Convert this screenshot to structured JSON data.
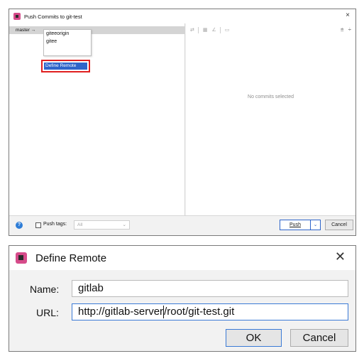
{
  "push_window": {
    "title": "Push Commits to git-test",
    "close_glyph": "×",
    "branch_prefix": "master →",
    "remote_options": [
      "giteeorigin",
      "gitee"
    ],
    "define_remote_label": "Define Remote",
    "empty_state": "No commits selected",
    "toolbar_icons": [
      "move-icon",
      "group-icon",
      "edit-icon",
      "commit-icon"
    ],
    "right_icons": [
      "expand-all-icon",
      "collapse-all-icon"
    ],
    "push_tags_label": "Push tags:",
    "push_tags_value": "All",
    "push_label": "Push",
    "cancel_label": "Cancel",
    "colors": {
      "highlight_border": "#e02020",
      "selected_bg": "#2f65ca",
      "accent": "#2f65ca"
    }
  },
  "define_remote": {
    "title": "Define Remote",
    "close_glyph": "✕",
    "name_label": "Name:",
    "name_value": "gitlab",
    "url_label": "URL:",
    "url_value_before_caret": "http://gitlab-server",
    "url_value_after_caret": "/root/git-test.git",
    "ok_label": "OK",
    "cancel_label": "Cancel"
  }
}
